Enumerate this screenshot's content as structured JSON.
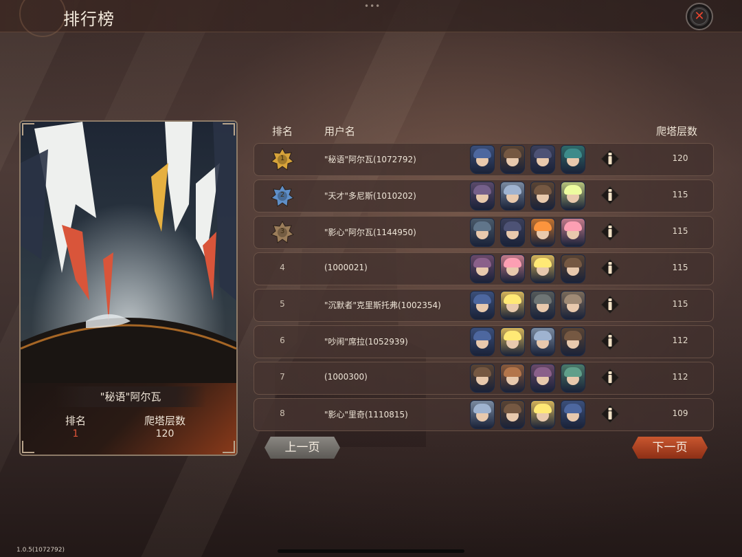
{
  "header": {
    "title": "排行榜",
    "menu_dots": "•••"
  },
  "featured": {
    "name": "\"秘语\"阿尔瓦",
    "rank_label": "排名",
    "rank_value": "1",
    "floor_label": "爬塔层数",
    "floor_value": "120"
  },
  "columns": {
    "rank": "排名",
    "user": "用户名",
    "floor": "爬塔层数"
  },
  "rows": [
    {
      "rank": "1",
      "badge": "gold",
      "name": "\"秘语\"阿尔瓦(1072792)",
      "floor": "120",
      "heroes": [
        "#3b4f7a",
        "#5a4433",
        "#3b3f5a",
        "#2f6b6a"
      ]
    },
    {
      "rank": "2",
      "badge": "blue",
      "name": "\"天才\"多尼斯(1010202)",
      "floor": "115",
      "heroes": [
        "#5a4a6a",
        "#7a8aa0",
        "#5a4433",
        "#b6c27a"
      ]
    },
    {
      "rank": "3",
      "badge": "bronze",
      "name": "\"影心\"阿尔瓦(1144950)",
      "floor": "115",
      "heroes": [
        "#4a5a6a",
        "#3b3f5a",
        "#c2722f",
        "#c27a8a"
      ]
    },
    {
      "rank": "4",
      "badge": "",
      "name": "(1000021)",
      "floor": "115",
      "heroes": [
        "#6a4a6a",
        "#c27a8a",
        "#d4b35a",
        "#5a4433"
      ]
    },
    {
      "rank": "5",
      "badge": "",
      "name": "\"沉默者\"克里斯托弗(1002354)",
      "floor": "115",
      "heroes": [
        "#3b4f7a",
        "#d4b35a",
        "#555a5a",
        "#7a6a5a"
      ]
    },
    {
      "rank": "6",
      "badge": "",
      "name": "\"吵闹\"席拉(1052939)",
      "floor": "112",
      "heroes": [
        "#3b4f7a",
        "#d4b35a",
        "#7a8aa0",
        "#5a4433"
      ]
    },
    {
      "rank": "7",
      "badge": "",
      "name": "(1000300)",
      "floor": "112",
      "heroes": [
        "#5a4433",
        "#8a5a3a",
        "#6a4a6a",
        "#4a7a6a"
      ]
    },
    {
      "rank": "8",
      "badge": "",
      "name": "\"影心\"里奇(1110815)",
      "floor": "109",
      "heroes": [
        "#7a8aa0",
        "#5a4433",
        "#d4b35a",
        "#3b4f7a"
      ]
    }
  ],
  "buttons": {
    "prev": "上一页",
    "next": "下一页"
  },
  "version": "1.0.5(1072792)",
  "icons": {
    "close": "close-icon",
    "info": "info-icon"
  },
  "colors": {
    "accent_red": "#e8452f",
    "rank_value": "#e0553a",
    "gold": "#d7a33a",
    "blue": "#5f8fc8",
    "bronze": "#9b7d5a",
    "next_button": "#b0441f"
  }
}
